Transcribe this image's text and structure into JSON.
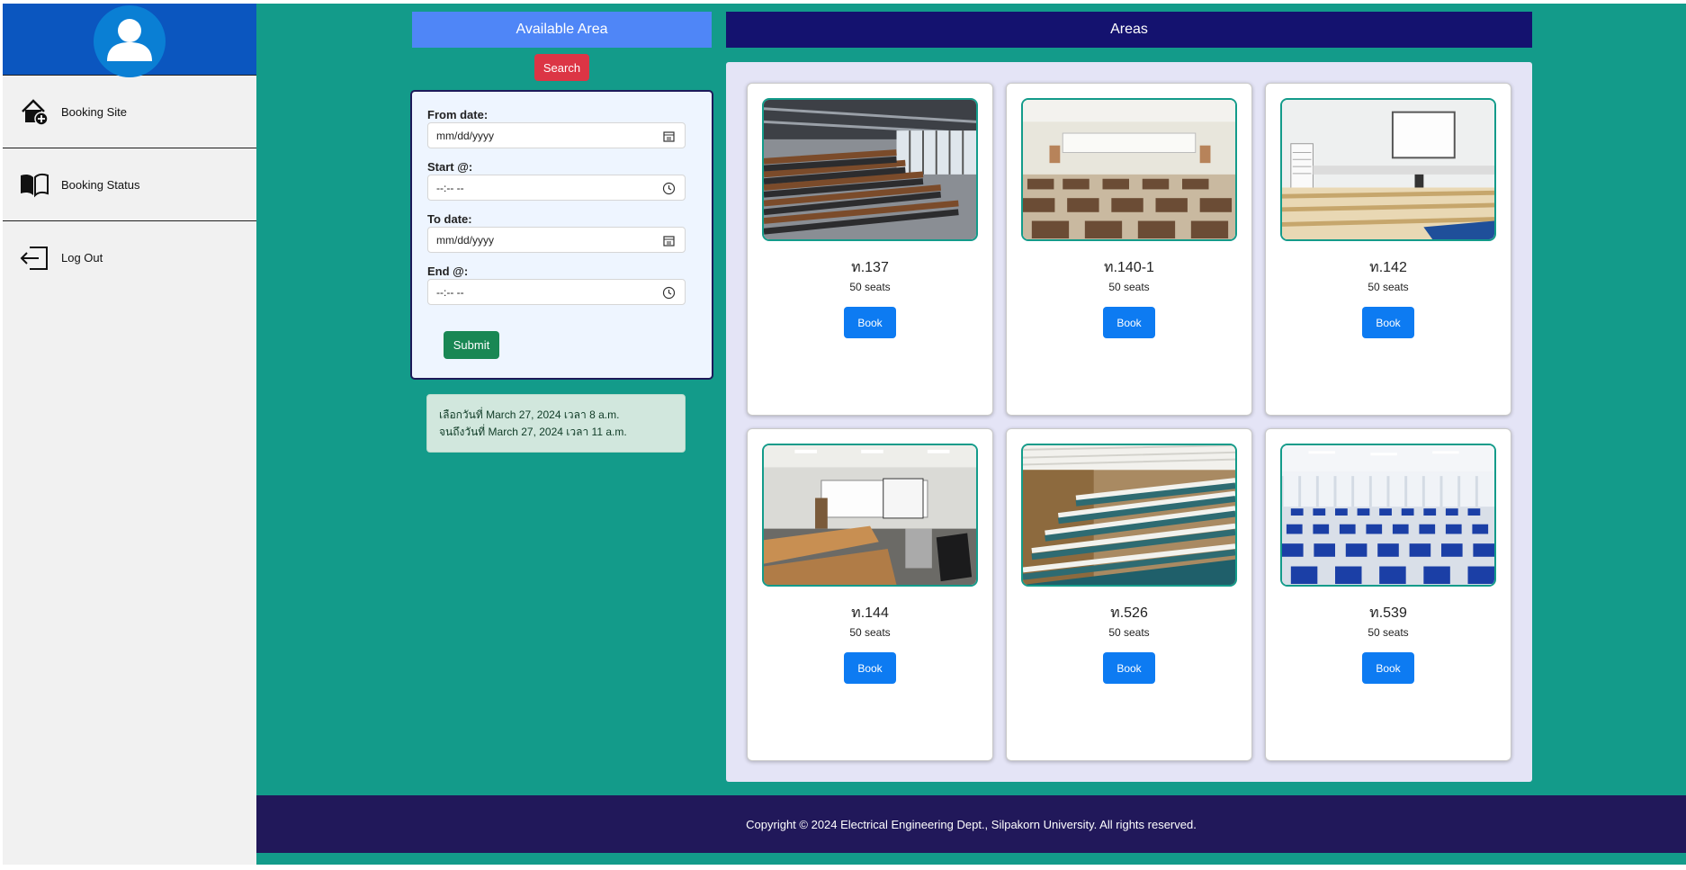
{
  "sidebar": {
    "items": [
      {
        "label": "Booking Site",
        "icon": "house-plus-icon"
      },
      {
        "label": "Booking Status",
        "icon": "book-icon"
      },
      {
        "label": "Log Out",
        "icon": "logout-icon"
      }
    ]
  },
  "left_panel": {
    "title": "Available Area",
    "search_label": "Search",
    "form": {
      "from_date_label": "From date:",
      "from_date_value": "mm/dd/yyyy",
      "start_label": "Start @:",
      "start_value": "--:-- --",
      "to_date_label": "To date:",
      "to_date_value": "mm/dd/yyyy",
      "end_label": "End @:",
      "end_value": "--:-- --",
      "submit_label": "Submit"
    },
    "selection": {
      "line1": "เลือกวันที่ March 27, 2024 เวลา 8 a.m.",
      "line2": "จนถึงวันที่ March 27, 2024 เวลา 11 a.m."
    }
  },
  "areas": {
    "title": "Areas",
    "rooms": [
      {
        "name": "ท.137",
        "seats": "50 seats",
        "book_label": "Book"
      },
      {
        "name": "ท.140-1",
        "seats": "50 seats",
        "book_label": "Book"
      },
      {
        "name": "ท.142",
        "seats": "50 seats",
        "book_label": "Book"
      },
      {
        "name": "ท.144",
        "seats": "50 seats",
        "book_label": "Book"
      },
      {
        "name": "ท.526",
        "seats": "50 seats",
        "book_label": "Book"
      },
      {
        "name": "ท.539",
        "seats": "50 seats",
        "book_label": "Book"
      }
    ]
  },
  "footer": {
    "copyright": "Copyright © 2024 Electrical Engineering Dept., Silpakorn University. All rights reserved."
  },
  "colors": {
    "page_bg": "#139b8a",
    "sidebar_head": "#0b56bf",
    "available_title": "#4f86f7",
    "areas_title": "#14126f",
    "footer": "#21185a",
    "book_button": "#0d7bf2",
    "search_button": "#dc3545",
    "submit_button": "#198754"
  }
}
